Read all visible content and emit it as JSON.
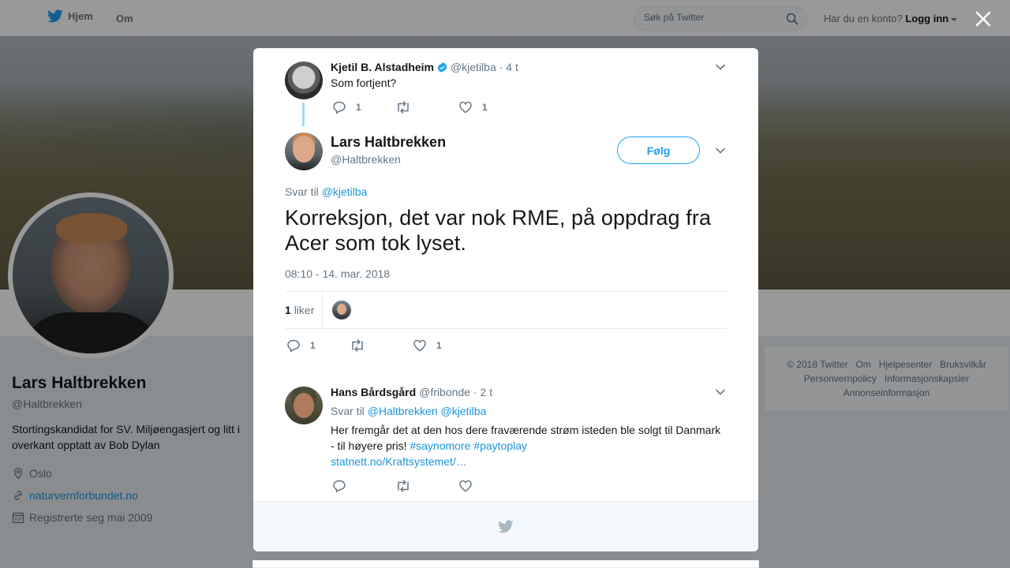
{
  "topbar": {
    "home_label": "Hjem",
    "about_label": "Om",
    "search_placeholder": "Søk på Twitter",
    "account_prompt": "Har du en konto?",
    "login_label": "Logg inn"
  },
  "profile": {
    "name": "Lars Haltbrekken",
    "handle": "@Haltbrekken",
    "bio": "Stortingskandidat for SV. Miljøengasjert og litt i overkant opptatt av Bob Dylan",
    "location": "Oslo",
    "website": "naturvernforbundet.no",
    "joined": "Registrerte seg mai 2009"
  },
  "footer": {
    "links": [
      "© 2018 Twitter",
      "Om",
      "Hjelpesenter",
      "Bruksvilkår",
      "Personvernpolicy",
      "Informasjonskapsler",
      "Annonseinformasjon"
    ]
  },
  "modal": {
    "parent_tweet": {
      "name": "Kjetil B. Alstadheim",
      "handle": "@kjetilba",
      "time": "· 4 t",
      "text": "Som fortjent?",
      "replies": "1",
      "likes": "1",
      "verified": true
    },
    "main_tweet": {
      "name": "Lars Haltbrekken",
      "handle": "@Haltbrekken",
      "follow_label": "Følg",
      "reply_prefix": "Svar til",
      "reply_to": "@kjetilba",
      "text": "Korreksjon, det var nok RME, på oppdrag fra Acer som tok lyset.",
      "timestamp": "08:10 - 14. mar. 2018",
      "like_count": "1",
      "like_label": "liker",
      "replies": "1",
      "likes": "1"
    },
    "reply_tweet": {
      "name": "Hans Bårdsgård",
      "handle": "@fribonde",
      "time": "· 2 t",
      "reply_prefix": "Svar til",
      "reply_to_1": "@Haltbrekken",
      "reply_to_2": "@kjetilba",
      "text": "Her fremgår det at den hos dere fraværende strøm isteden ble solgt til Danmark - til høyere pris!",
      "hashtag_1": "#saynomore",
      "hashtag_2": "#paytoplay",
      "link": "statnett.no/Kraftsystemet/…"
    }
  },
  "colors": {
    "accent": "#1da1f2",
    "link": "#1b95e0",
    "muted": "#657786",
    "text": "#14171a"
  }
}
